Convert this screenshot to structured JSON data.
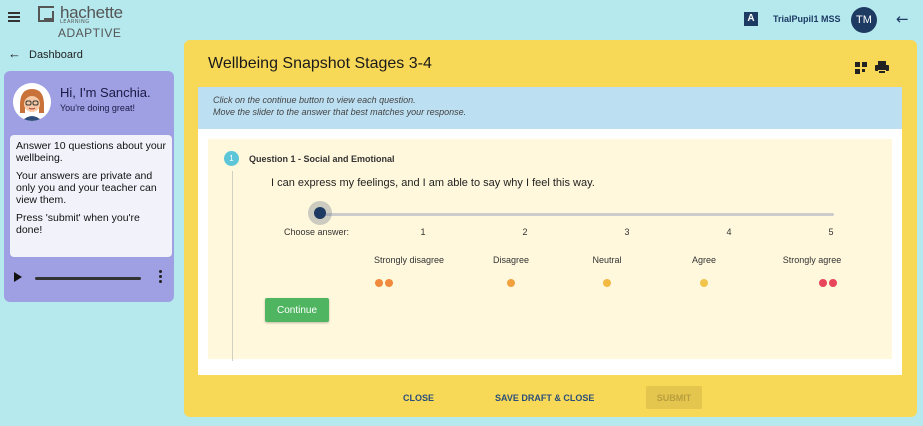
{
  "header": {
    "logo": {
      "name": "hachette",
      "sub": "LEARNING",
      "product": "ADAPTIVE"
    },
    "language_badge": "A",
    "user_name": "TrialPupil1 MSS",
    "user_initials": "TM"
  },
  "nav": {
    "dashboard_label": "Dashboard"
  },
  "assistant": {
    "greeting": "Hi, I'm Sanchia.",
    "subtitle": "You're doing great!",
    "messages": [
      "Answer 10 questions about your wellbeing.",
      "Your answers are private and only you and your teacher can view them.",
      "Press 'submit' when you're done!"
    ]
  },
  "survey": {
    "title": "Wellbeing Snapshot Stages 3-4",
    "instructions": [
      "Click on the continue button to view each question.",
      "Move the slider to the answer that best matches your response."
    ],
    "question": {
      "number": "1",
      "heading": "Question 1 - Social and Emotional",
      "text": "I can express my feelings, and I am able to say why I feel this way.",
      "choose_label": "Choose answer:",
      "selected_value": null,
      "scale": [
        "1",
        "2",
        "3",
        "4",
        "5"
      ],
      "options": [
        "Strongly disagree",
        "Disagree",
        "Neutral",
        "Agree",
        "Strongly agree"
      ],
      "emoji_colors": [
        "#f08a3c",
        "#f2a13e",
        "#f4b942",
        "#f2c44a",
        "#e8455a"
      ]
    },
    "continue_label": "Continue"
  },
  "footer": {
    "close_label": "CLOSE",
    "save_label": "SAVE DRAFT & CLOSE",
    "submit_label": "SUBMIT"
  }
}
